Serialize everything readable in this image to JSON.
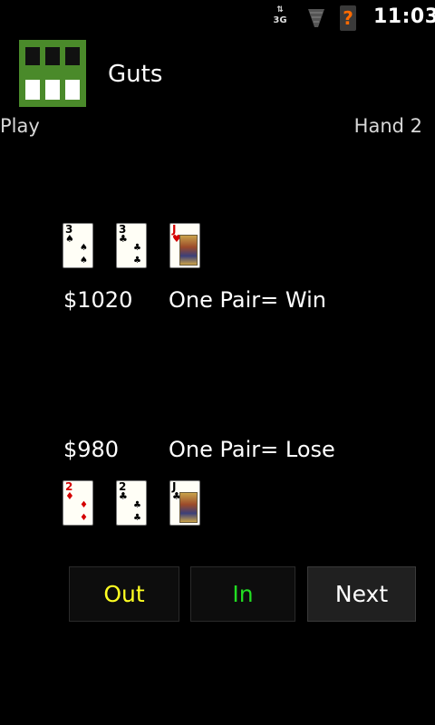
{
  "status_bar": {
    "network": "3G",
    "signal_icon": "signal-icon",
    "battery_icon": "battery-unknown-icon",
    "battery_symbol": "?",
    "time": "11:03"
  },
  "header": {
    "app_icon": "cards-grid-icon",
    "title": "Guts"
  },
  "info": {
    "mode": "Play",
    "hand": "Hand 2"
  },
  "opponent": {
    "amount": "$1020",
    "result": "One Pair= Win",
    "cards": [
      {
        "rank": "3",
        "suit": "♠",
        "color": "black"
      },
      {
        "rank": "3",
        "suit": "♣",
        "color": "black"
      },
      {
        "rank": "J",
        "suit": "♥",
        "color": "red"
      }
    ]
  },
  "player": {
    "amount": "$980",
    "result": "One Pair= Lose",
    "cards": [
      {
        "rank": "2",
        "suit": "♦",
        "color": "red"
      },
      {
        "rank": "2",
        "suit": "♣",
        "color": "black"
      },
      {
        "rank": "J",
        "suit": "♣",
        "color": "black"
      }
    ]
  },
  "buttons": {
    "out": "Out",
    "in": "In",
    "next": "Next"
  },
  "colors": {
    "out": "#ffff22",
    "in": "#22dd22",
    "icon": "#4a8a2a"
  }
}
